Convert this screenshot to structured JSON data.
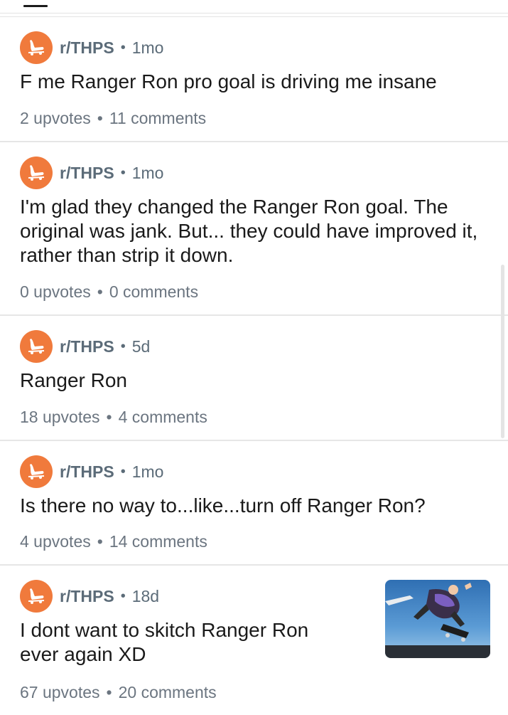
{
  "posts": [
    {
      "subreddit": "r/THPS",
      "age": "1mo",
      "title": "F me Ranger Ron pro goal is driving me insane",
      "upvotes": "2 upvotes",
      "comments": "11 comments"
    },
    {
      "subreddit": "r/THPS",
      "age": "1mo",
      "title": "I'm glad they changed the Ranger Ron goal. The original was jank. But... they could have improved it, rather than strip it down.",
      "upvotes": "0 upvotes",
      "comments": "0 comments"
    },
    {
      "subreddit": "r/THPS",
      "age": "5d",
      "title": "Ranger Ron",
      "upvotes": "18 upvotes",
      "comments": "4 comments"
    },
    {
      "subreddit": "r/THPS",
      "age": "1mo",
      "title": "Is there no way to...like...turn off Ranger Ron?",
      "upvotes": "4 upvotes",
      "comments": "14 comments"
    },
    {
      "subreddit": "r/THPS",
      "age": "18d",
      "title": "I dont want to skitch Ranger Ron ever again XD",
      "upvotes": "67 upvotes",
      "comments": "20 comments",
      "thumbnail": "skater-thumbnail"
    }
  ],
  "separator": "•",
  "colors": {
    "avatar": "#f07a3c",
    "meta": "#5b6b78"
  },
  "icons": {
    "avatar": "skater-icon"
  }
}
